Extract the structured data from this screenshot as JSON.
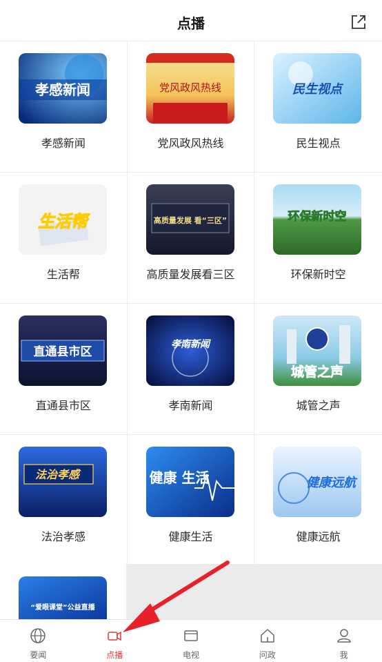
{
  "header": {
    "title": "点播",
    "share_icon": "share-external-icon"
  },
  "programs": [
    [
      {
        "label": "孝感新闻",
        "thumb_text": "孝感新闻"
      },
      {
        "label": "党风政风热线",
        "thumb_text": "党风政风热线"
      },
      {
        "label": "民生视点",
        "thumb_text": "民生视点"
      }
    ],
    [
      {
        "label": "生活帮",
        "thumb_text": "生活帮"
      },
      {
        "label": "高质量发展看三区",
        "thumb_text": "高质量发展 看“三区”"
      },
      {
        "label": "环保新时空",
        "thumb_text": "环保新时空"
      }
    ],
    [
      {
        "label": "直通县市区",
        "thumb_text": "直通县市区"
      },
      {
        "label": "孝南新闻",
        "thumb_text": "孝南新闻"
      },
      {
        "label": "城管之声",
        "thumb_text": "城管之声"
      }
    ],
    [
      {
        "label": "法治孝感",
        "thumb_text": "法治孝感"
      },
      {
        "label": "健康生活",
        "thumb_text": "健康 生活"
      },
      {
        "label": "健康远航",
        "thumb_text": "健康远航"
      }
    ]
  ],
  "partial_program": {
    "thumb_text": "“爱眼课堂”公益直播"
  },
  "tabbar": [
    {
      "label": "要闻",
      "icon": "globe-icon"
    },
    {
      "label": "点播",
      "icon": "video-camera-icon",
      "active": true
    },
    {
      "label": "电视",
      "icon": "tv-icon"
    },
    {
      "label": "问政",
      "icon": "home-icon"
    },
    {
      "label": "我",
      "icon": "user-icon"
    }
  ],
  "colors": {
    "accent": "#e53935",
    "arrow": "#e8202a"
  }
}
